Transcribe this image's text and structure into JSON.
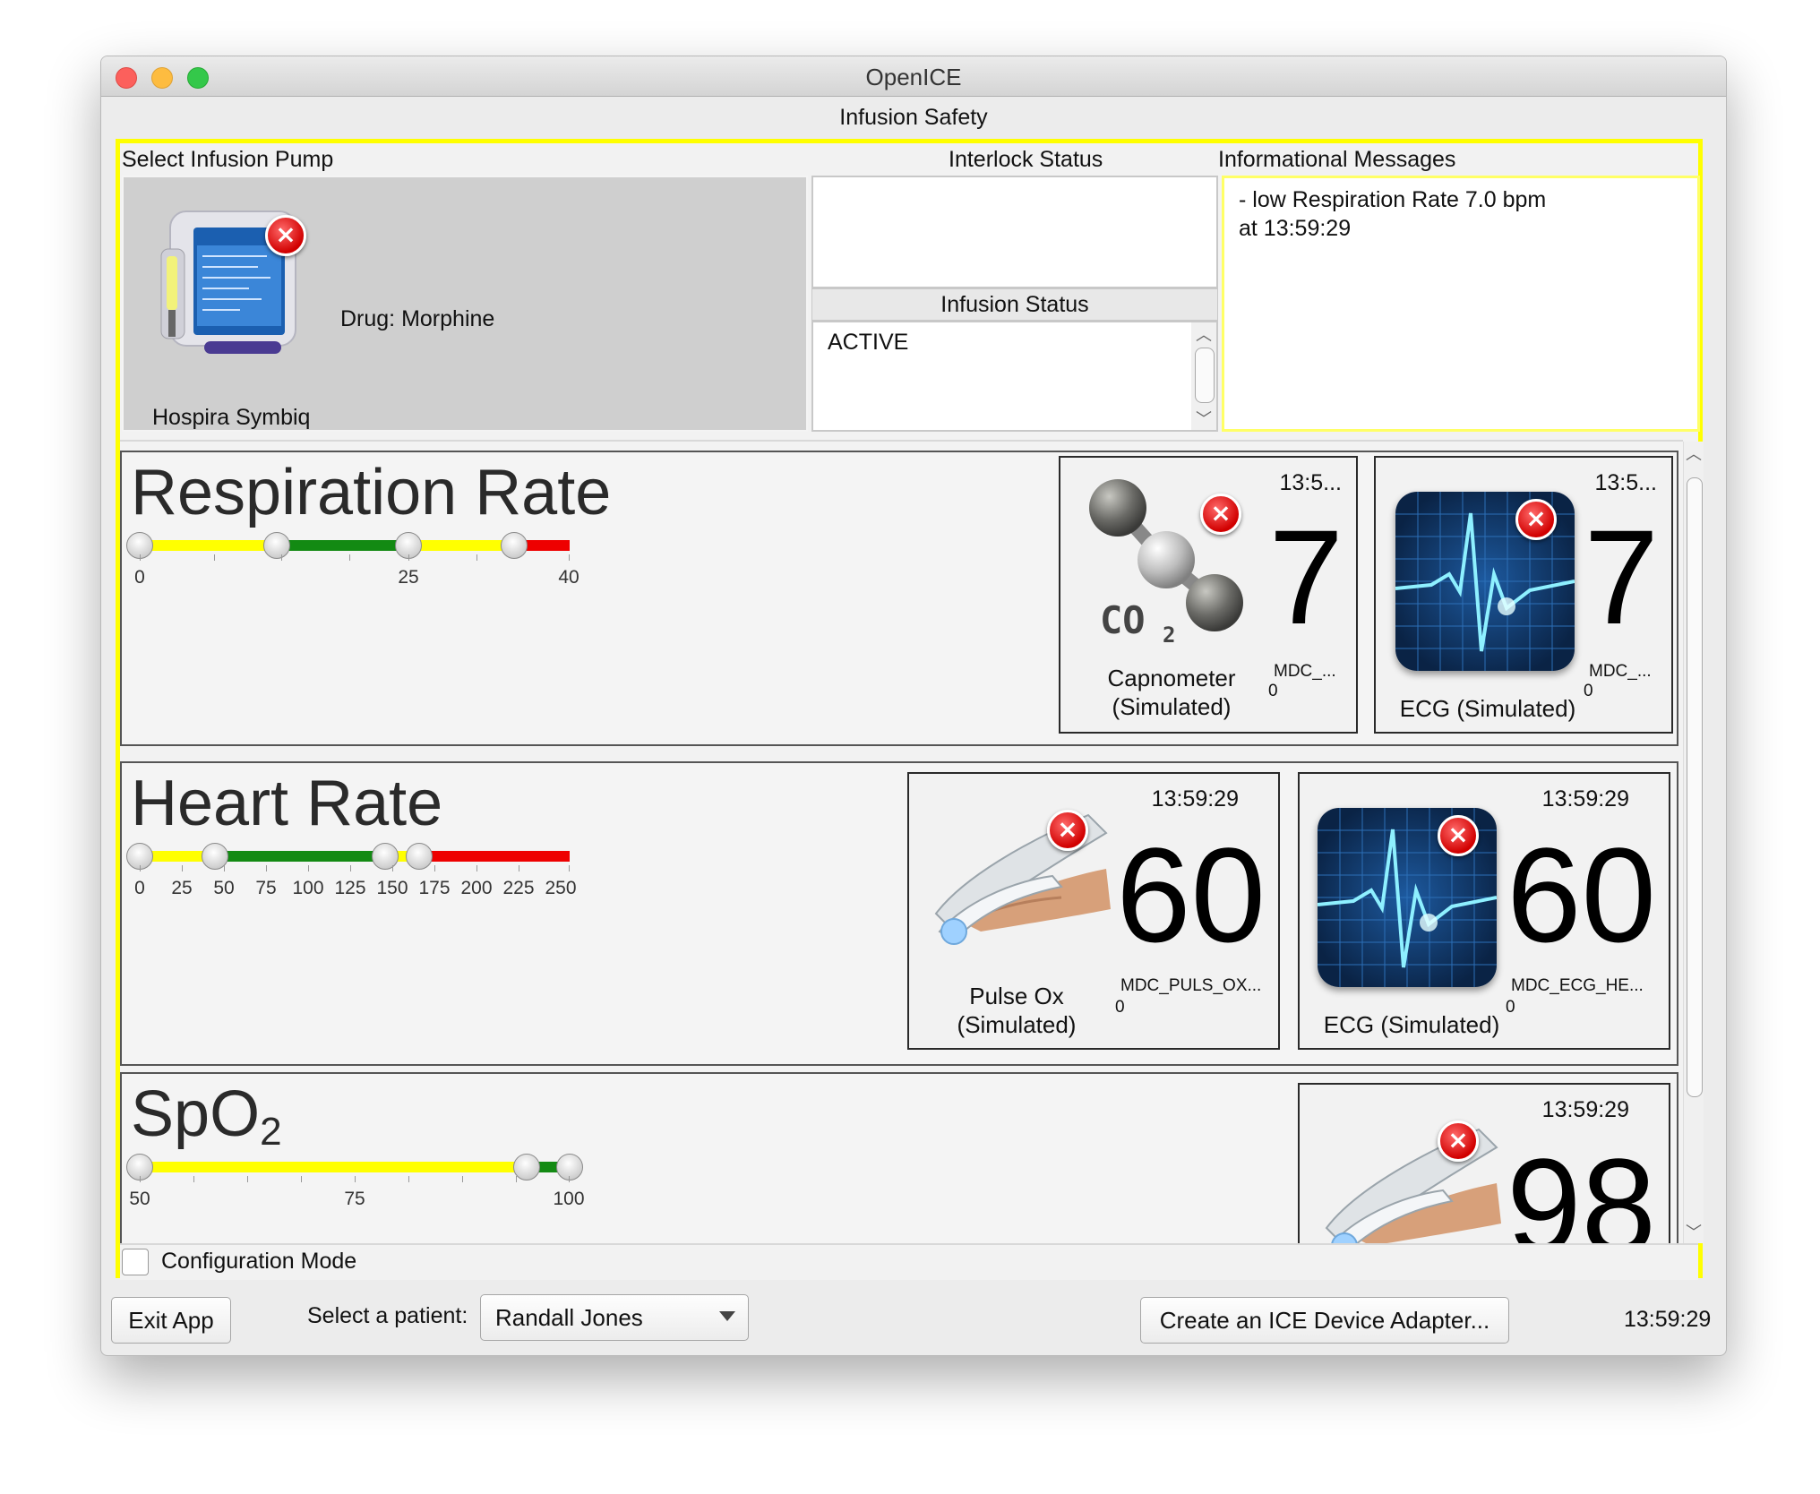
{
  "window": {
    "title": "OpenICE"
  },
  "app": {
    "title": "Infusion Safety"
  },
  "pump_section": {
    "header": "Select Infusion Pump",
    "drug": "Drug: Morphine",
    "pump_name": "Hospira Symbiq",
    "icon": "infusion-pump-icon"
  },
  "interlock": {
    "header": "Interlock Status",
    "value": ""
  },
  "infusion_status": {
    "header": "Infusion Status",
    "value": "ACTIVE"
  },
  "messages": {
    "header": "Informational Messages",
    "lines": [
      "- low Respiration Rate 7.0 bpm",
      "at 13:59:29"
    ]
  },
  "metrics": [
    {
      "title": "Respiration Rate",
      "ticks": [
        "0",
        "25",
        "40"
      ],
      "devices": [
        {
          "time": "13:5...",
          "value": "7",
          "metric_id": "MDC_...",
          "index": "0",
          "name_lines": [
            "Capnometer",
            "(Simulated)"
          ],
          "icon": "co2-molecule-icon"
        },
        {
          "time": "13:5...",
          "value": "7",
          "metric_id": "MDC_...",
          "index": "0",
          "name_lines": [
            "ECG (Simulated)"
          ],
          "icon": "ecg-icon"
        }
      ]
    },
    {
      "title": "Heart Rate",
      "ticks": [
        "0",
        "25",
        "50",
        "75",
        "100",
        "125",
        "150",
        "175",
        "200",
        "225",
        "250"
      ],
      "devices": [
        {
          "time": "13:59:29",
          "value": "60",
          "metric_id": "MDC_PULS_OX...",
          "index": "0",
          "name_lines": [
            "Pulse Ox",
            "(Simulated)"
          ],
          "icon": "pulse-oximeter-icon"
        },
        {
          "time": "13:59:29",
          "value": "60",
          "metric_id": "MDC_ECG_HE...",
          "index": "0",
          "name_lines": [
            "ECG (Simulated)"
          ],
          "icon": "ecg-icon"
        }
      ]
    },
    {
      "title": "SpO",
      "title_sub": "2",
      "ticks": [
        "50",
        "75",
        "100"
      ],
      "devices": [
        {
          "time": "13:59:29",
          "value": "98",
          "icon": "pulse-oximeter-icon"
        }
      ]
    }
  ],
  "config_mode": {
    "label": "Configuration Mode",
    "checked": false
  },
  "footer": {
    "exit_label": "Exit App",
    "patient_label": "Select a patient:",
    "patient_value": "Randall Jones",
    "create_adapter_label": "Create an ICE Device Adapter...",
    "clock": "13:59:29"
  },
  "colors": {
    "accent_border": "#ffff00",
    "range_yellow": "#ffff00",
    "range_green": "#138a13",
    "range_red": "#ee0000",
    "alarm_badge": "#d10000"
  }
}
